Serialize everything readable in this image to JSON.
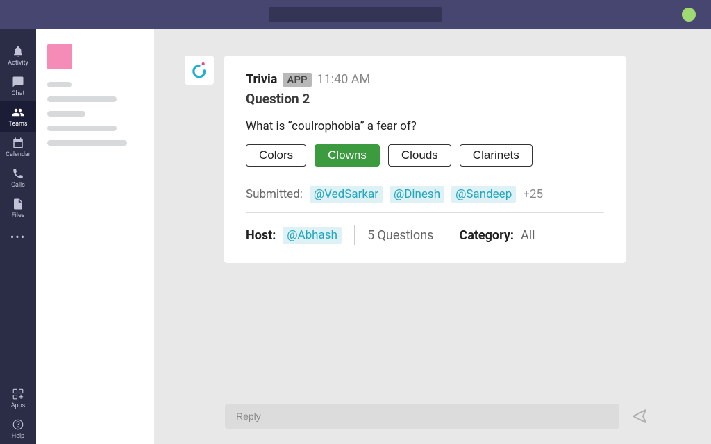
{
  "rail": {
    "activity": "Activity",
    "chat": "Chat",
    "teams": "Teams",
    "calendar": "Calendar",
    "calls": "Calls",
    "files": "Files",
    "apps": "Apps",
    "help": "Help"
  },
  "message": {
    "app_name": "Trivia",
    "app_badge": "APP",
    "timestamp": "11:40 AM",
    "question_title": "Question 2",
    "question_text": "What is “coulrophobia” a fear of?",
    "options": [
      "Colors",
      "Clowns",
      "Clouds",
      "Clarinets"
    ],
    "selected_index": 1,
    "submitted_label": "Submitted:",
    "submitted_users": [
      "@VedSarkar",
      "@Dinesh",
      "@Sandeep"
    ],
    "submitted_more": "+25",
    "host_label": "Host:",
    "host": "@Abhash",
    "question_count": "5 Questions",
    "category_label": "Category:",
    "category_value": "All"
  },
  "reply": {
    "placeholder": "Reply"
  }
}
